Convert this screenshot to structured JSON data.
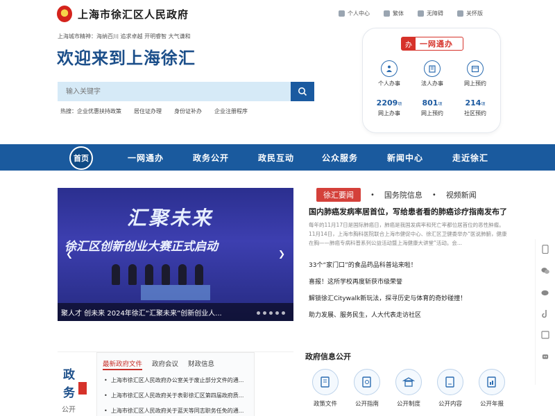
{
  "header": {
    "site_title": "上海市徐汇区人民政府",
    "slogan": "上海城市精神：海纳百川 追求卓越 开明睿智 大气谦和",
    "welcome": "欢迎来到上海徐汇",
    "toplinks": [
      "个人中心",
      "繁体",
      "无障碍",
      "关怀版"
    ]
  },
  "search": {
    "placeholder": "输入关键字",
    "hot_label": "热搜：",
    "hot": [
      "企业优惠扶持政策",
      "居住证办理",
      "身份证补办",
      "企业注册程序"
    ]
  },
  "service": {
    "brand": "一网通办",
    "brand_mark": "办",
    "items": [
      "个人办事",
      "法人办事",
      "网上预约"
    ],
    "stats": [
      {
        "num": "2209",
        "unit": "项",
        "label": "网上办事"
      },
      {
        "num": "801",
        "unit": "项",
        "label": "网上预约"
      },
      {
        "num": "214",
        "unit": "项",
        "label": "社区预约"
      }
    ]
  },
  "nav": {
    "home": "首页",
    "items": [
      "一网通办",
      "政务公开",
      "政民互动",
      "公众服务",
      "新闻中心",
      "走近徐汇"
    ]
  },
  "carousel": {
    "big_line1": "汇聚未来",
    "big_line2": "徐汇区创新创业大赛正式启动",
    "caption": "聚人才 创未来 2024年徐汇“汇聚未来”创新创业人..."
  },
  "news": {
    "tabs": [
      "徐汇要闻",
      "国务院信息",
      "视频新闻"
    ],
    "headline": "国内肺癌发病率居首位，写给患者看的肺癌诊疗指南发布了",
    "summary": "每年的11月17日是国际肺癌日，肺癌是我国发病率和死亡率都位居首位的恶性肿瘤。11月14日，上海市胸科医院联合上海市健促中心、徐汇区卫健委举办“医说肺腑，健康在胸——肺癌专病科普系列公益活动暨上海健康大讲堂”活动。会...",
    "items": [
      "33个“家门口”的食品药品科普站来啦！",
      "喜报！这所学校再度斩获市级荣誉",
      "解锁徐汇Citywalk新玩法，探寻历史与体育的奇妙碰撞！",
      "助力发展、服务民生，人大代表走访社区"
    ]
  },
  "zhengwu": {
    "side_chars": [
      "政",
      "务"
    ],
    "side_sub": "公开",
    "tabs": [
      "最新政府文件",
      "政府会议",
      "财政信息"
    ],
    "items": [
      "上海市徐汇区人民政府办公室关于废止部分文件的通...",
      "上海市徐汇区人民政府关于表彰徐汇区第四届政府质...",
      "上海市徐汇区人民政府关于蓝天等同志职务任免的通..."
    ]
  },
  "gov_info": {
    "title": "政府信息公开",
    "items": [
      "政策文件",
      "公开指南",
      "公开制度",
      "公开内容",
      "公开年报"
    ]
  },
  "colors": {
    "primary": "#1a5a9e",
    "accent_red": "#d4403a",
    "search_bg": "#d6eaf7"
  }
}
